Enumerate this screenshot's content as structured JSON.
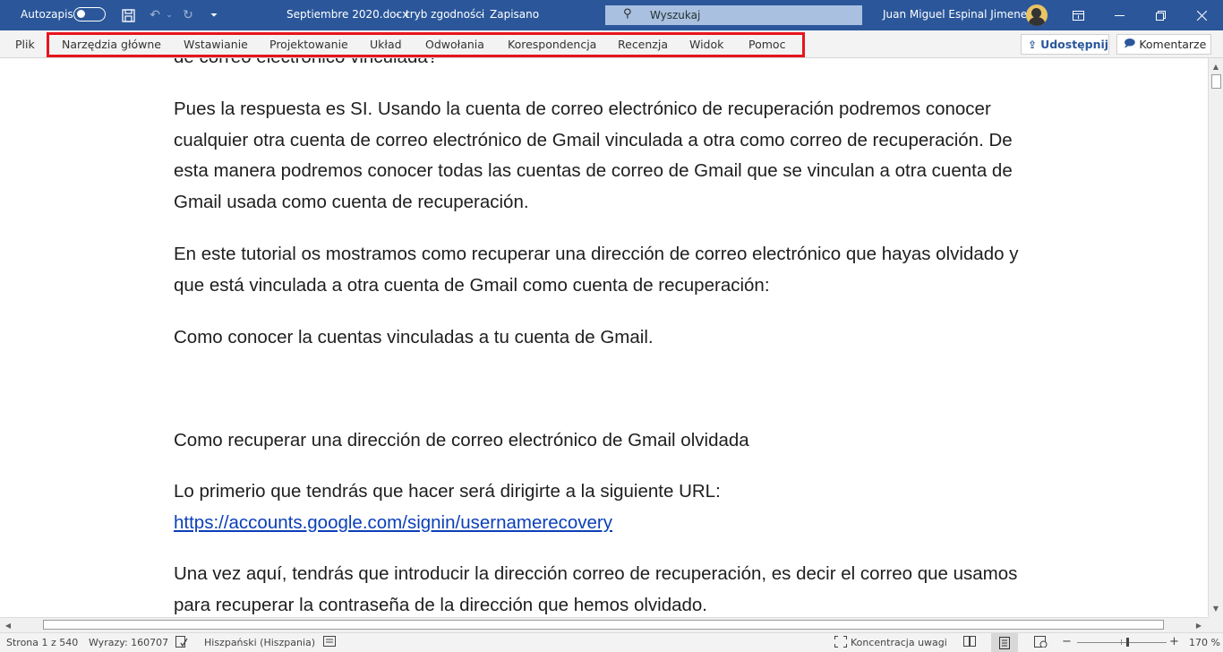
{
  "titlebar": {
    "autosave_label": "Autozapis",
    "doc_name": "Septiembre 2020.docx",
    "sep": "-",
    "mode": "tryb zgodności",
    "status": "Zapisano",
    "search_placeholder": "Wyszukaj",
    "user_name": "Juan Miguel Espinal Jimenez",
    "accent_color": "#2b579a"
  },
  "ribbon": {
    "file_tab": "Plik",
    "tabs": [
      "Narzędzia główne",
      "Wstawianie",
      "Projektowanie",
      "Układ",
      "Odwołania",
      "Korespondencja",
      "Recenzja",
      "Widok",
      "Pomoc"
    ],
    "share_label": "Udostępnij",
    "comments_label": "Komentarze",
    "highlight_color": "#e8141d"
  },
  "document": {
    "line_top": "de correo electrónico vinculada?",
    "p1": "Pues la respuesta es SI. Usando la cuenta de correo electrónico de recuperación podremos conocer cualquier otra cuenta de correo electrónico de Gmail vinculada a otra como correo de recuperación. De esta manera podremos conocer todas las cuentas de correo de Gmail que se vinculan a otra cuenta de Gmail usada como cuenta de recuperación.",
    "p2": "En este tutorial os mostramos como recuperar una dirección de correo electrónico que hayas olvidado y que está vinculada a otra cuenta de Gmail como cuenta de recuperación:",
    "p3": "Como conocer la cuentas vinculadas a tu cuenta de Gmail.",
    "p4": "Como recuperar una dirección de correo electrónico de Gmail olvidada",
    "p5": "Lo primerio que tendrás que hacer será dirigirte a la siguiente URL:",
    "link": "https://accounts.google.com/signin/usernamerecovery",
    "p6": "Una vez aquí, tendrás que introducir la dirección correo de recuperación, es decir el correo que usamos para recuperar la contraseña de la dirección que hemos olvidado."
  },
  "statusbar": {
    "page": "Strona 1 z 540",
    "words": "Wyrazy: 160707",
    "language": "Hiszpański (Hiszpania)",
    "focus": "Koncentracja uwagi",
    "zoom_minus": "−",
    "zoom_plus": "+",
    "zoom": "170 %",
    "zoom_percent": 170
  }
}
